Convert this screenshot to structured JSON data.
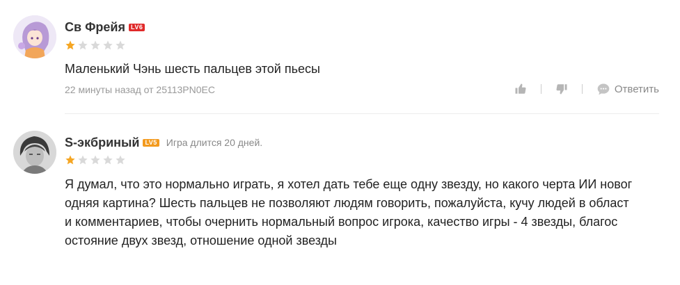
{
  "comments": [
    {
      "username": "Св Фрейя",
      "level": "LV6",
      "rating": 1,
      "text": "Маленький Чэнь шесть пальцев этой пьесы",
      "meta": "22 минуты назад от 25113PN0EC",
      "reply_label": "Ответить"
    },
    {
      "username": "S-экбриный",
      "level": "LV5",
      "playtime": "Игра длится 20 дней.",
      "rating": 1,
      "text_lines": [
        "Я думал, что это нормально играть, я хотел дать тебе еще одну звезду, но какого черта ИИ новог",
        "одняя картина? Шесть пальцев не позволяют людям говорить, пожалуйста, кучу людей в област",
        "и комментариев, чтобы очернить нормальный вопрос игрока, качество игры - 4 звезды, благос",
        "остояние двух звезд, отношение одной звезды"
      ]
    }
  ],
  "colors": {
    "star_filled": "#f5a623",
    "star_empty": "#d9d9d9",
    "level_red": "#e02a2a",
    "level_orange": "#f39a1e"
  },
  "icons": [
    "thumbs-up-icon",
    "thumbs-down-icon",
    "chat-bubble-icon",
    "star-icon"
  ]
}
